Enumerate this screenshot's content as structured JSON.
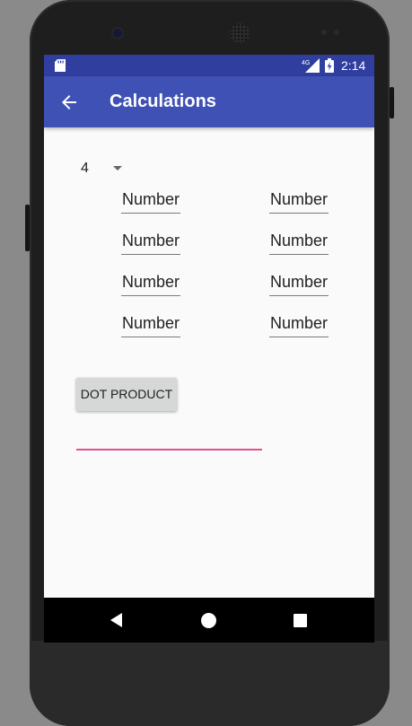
{
  "status_bar": {
    "time": "2:14",
    "network_label": "4G",
    "icons": [
      "sd-card-icon",
      "signal-icon",
      "battery-icon"
    ]
  },
  "app_bar": {
    "title": "Calculations",
    "back_icon": "arrow-back-icon"
  },
  "spinner": {
    "selected_value": "4"
  },
  "vector_fields": {
    "rows": [
      {
        "left_placeholder": "Number",
        "right_placeholder": "Number"
      },
      {
        "left_placeholder": "Number",
        "right_placeholder": "Number"
      },
      {
        "left_placeholder": "Number",
        "right_placeholder": "Number"
      },
      {
        "left_placeholder": "Number",
        "right_placeholder": "Number"
      }
    ]
  },
  "dot_product_button": {
    "label": "DOT PRODUCT"
  },
  "result": {
    "value": ""
  },
  "navigation_bar": {
    "icons": [
      "nav-back-icon",
      "nav-home-icon",
      "nav-recents-icon"
    ]
  },
  "colors": {
    "status_bar": "#303f9f",
    "app_bar": "#3f51b5",
    "accent": "#e84e8c",
    "background": "#fafafa",
    "button": "#d6d7d7"
  }
}
